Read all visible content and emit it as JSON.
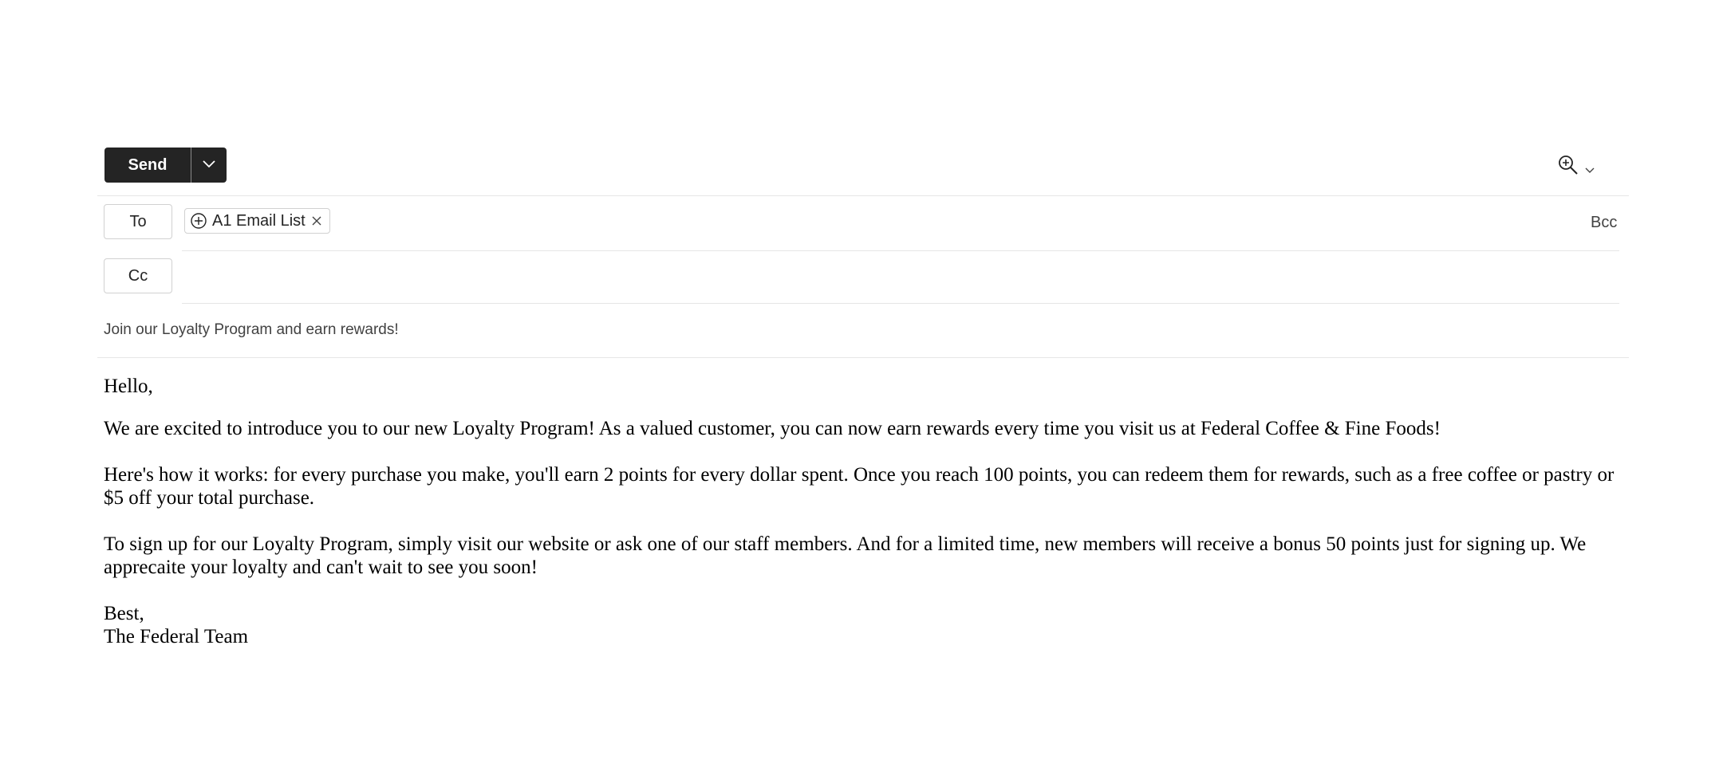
{
  "toolbar": {
    "send_label": "Send",
    "send_options_icon": "chevron-down-icon",
    "zoom_icon": "zoom-in-icon",
    "zoom_menu_icon": "chevron-down-icon"
  },
  "recipients": {
    "to_label": "To",
    "cc_label": "Cc",
    "bcc_label": "Bcc",
    "to_chips": [
      {
        "label": "A1 Email List",
        "icon": "add-circle-icon",
        "remove_icon": "close-icon"
      }
    ]
  },
  "subject": "Join our Loyalty Program and earn rewards!",
  "body": {
    "greeting": "Hello,",
    "p1": "We are excited to introduce you to our new Loyalty Program! As a valued customer, you can now earn rewards every time you visit us at Federal Coffee & Fine Foods!",
    "p2": "Here's how it works: for every purchase you make, you'll earn 2 points for every dollar spent. Once you reach 100 points, you can redeem them for rewards, such as a free coffee or pastry or $5 off your total purchase.",
    "p3": "To sign up for our Loyalty Program, simply visit our website or ask one of our staff members. And for a limited time, new members will receive a bonus 50 points just for signing up. We apprecaite your loyalty and can't wait to see you soon!",
    "closing": "Best,",
    "signature": "The Federal Team"
  },
  "colors": {
    "send_bg": "#242424",
    "border": "#d1d1d1",
    "divider": "#e6e6e6"
  }
}
